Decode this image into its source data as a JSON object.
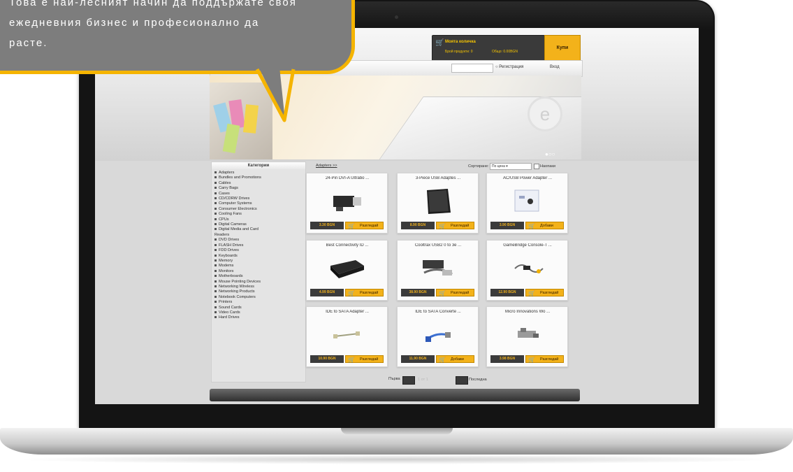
{
  "speech_bubble": {
    "line1": "Това е най-лесният начин да поддържате своя",
    "line2": "ежедневния  бизнес  и  професионално  да",
    "line3": "расте."
  },
  "cart": {
    "title": "Моята количка",
    "count": "Брой продукти: 0",
    "total": "Общо: 0.00BGN",
    "buy_label": "Купи"
  },
  "nav": {
    "register": "Регистрация",
    "login": "Вход"
  },
  "sidebar": {
    "title": "Категории",
    "items": [
      "Adapters",
      "Bundles and Promotions",
      "Cables",
      "Carry Bags",
      "Cases",
      "CD/CDRW Drives",
      "Computer Systems",
      "Consumer Electronics",
      "Cooling Fans",
      "CPUs",
      "Digital Cameras",
      "Digital Media and Card",
      "Readers",
      "DVD Drives",
      "FLASH Drives",
      "FDD Drives",
      "Keyboards",
      "Memory",
      "Modems",
      "Monitors",
      "Motherboards",
      "Mouse Pointing Devices",
      "Networking Wireless",
      "Networking Products",
      "Notebook Computers",
      "Printers",
      "Sound Cards",
      "Video Cards",
      "Hard Drives"
    ]
  },
  "main": {
    "breadcrumb": "Adapters >>",
    "sort_label": "Сортиране:",
    "sort_value": "По цена",
    "reverse_label": "Наопаки"
  },
  "products": [
    {
      "title": "24-Pin DVI-A Ultrabo ...",
      "price": "3.30 BGN",
      "action": "Разгледай",
      "icon": "dvi-adapter"
    },
    {
      "title": "3-Piece USB Adaptes ...",
      "price": "8.90 BGN",
      "action": "Разгледай",
      "icon": "black-case"
    },
    {
      "title": "AC/USB Power Adapter ...",
      "price": "3.90 BGN",
      "action": "Добави",
      "icon": "power-adapter"
    },
    {
      "title": "Best Connectivity ID ...",
      "price": "4.99 BGN",
      "action": "Разгледай",
      "icon": "black-hub"
    },
    {
      "title": "Cooltrax USB2 0 to 3e ...",
      "price": "38.90 BGN",
      "action": "Разгледай",
      "icon": "cable-kit"
    },
    {
      "title": "GameBridge Console-T ...",
      "price": "12.90 BGN",
      "action": "Разгледай",
      "icon": "cable-coil"
    },
    {
      "title": "IDE to SATA Adapter ...",
      "price": "10.90 BGN",
      "action": "Разгледай",
      "icon": "sata-cable"
    },
    {
      "title": "IDE to SATA Converte ...",
      "price": "11.90 BGN",
      "action": "Добави",
      "icon": "sata-converter"
    },
    {
      "title": "Micro Innovations Wo ...",
      "price": "3.98 BGN",
      "action": "Разгледай",
      "icon": "micro-adapter"
    }
  ],
  "pager": {
    "prev_label": "Първа",
    "info": "1 от 1",
    "next_label": "Последна"
  },
  "colors": {
    "accent": "#f3b21a",
    "bubble_bg": "#7d7d7d",
    "bubble_border": "#f5b400",
    "dark": "#3b3b3b"
  }
}
